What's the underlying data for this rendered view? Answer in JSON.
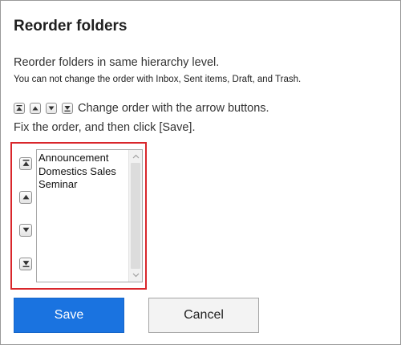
{
  "dialog": {
    "title": "Reorder folders",
    "description": "Reorder folders in same hierarchy level.",
    "note": "You can not change the order with Inbox, Sent items, Draft, and Trash.",
    "instruction_line1": "Change order with the arrow buttons.",
    "instruction_line2": "Fix the order, and then click [Save]."
  },
  "arrow_buttons": [
    "move-to-top-icon",
    "move-up-icon",
    "move-down-icon",
    "move-to-bottom-icon"
  ],
  "folders": {
    "items": [
      "Announcement",
      "Domestics Sales",
      "Seminar"
    ]
  },
  "buttons": {
    "save_label": "Save",
    "cancel_label": "Cancel"
  },
  "colors": {
    "highlight_border": "#d9262b",
    "save_button": "#1a73e0",
    "cancel_button": "#f3f3f3"
  }
}
